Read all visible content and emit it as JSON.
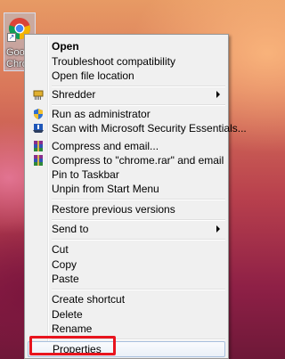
{
  "desktop_icon": {
    "label": "Goo\nChro"
  },
  "context_menu": {
    "items": [
      {
        "key": "open",
        "label": "Open",
        "bold": true
      },
      {
        "key": "troubleshoot",
        "label": "Troubleshoot compatibility"
      },
      {
        "key": "open_location",
        "label": "Open file location"
      },
      {
        "key": "shredder",
        "label": "Shredder",
        "icon": "shredder-icon",
        "submenu": true
      },
      {
        "key": "run_admin",
        "label": "Run as administrator",
        "icon": "uac-shield-icon"
      },
      {
        "key": "scan_mse",
        "label": "Scan with Microsoft Security Essentials...",
        "icon": "security-essentials-icon"
      },
      {
        "key": "compress_email",
        "label": "Compress and email...",
        "icon": "winrar-icon"
      },
      {
        "key": "compress_rar_email",
        "label": "Compress to \"chrome.rar\" and email",
        "icon": "winrar-icon"
      },
      {
        "key": "pin_taskbar",
        "label": "Pin to Taskbar"
      },
      {
        "key": "unpin_start",
        "label": "Unpin from Start Menu"
      },
      {
        "key": "restore_versions",
        "label": "Restore previous versions"
      },
      {
        "key": "send_to",
        "label": "Send to",
        "submenu": true
      },
      {
        "key": "cut",
        "label": "Cut"
      },
      {
        "key": "copy",
        "label": "Copy"
      },
      {
        "key": "paste",
        "label": "Paste"
      },
      {
        "key": "create_shortcut",
        "label": "Create shortcut"
      },
      {
        "key": "delete",
        "label": "Delete"
      },
      {
        "key": "rename",
        "label": "Rename"
      },
      {
        "key": "properties",
        "label": "Properties",
        "highlighted": true
      }
    ]
  },
  "colors": {
    "highlight_border": "#e8141e",
    "menu_bg": "#f0f0f0"
  }
}
